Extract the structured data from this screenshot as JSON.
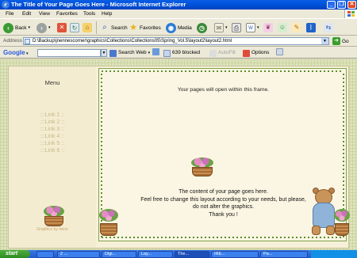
{
  "window": {
    "title": "The Title of Your Page Goes Here - Microsoft Internet Explorer",
    "minimize": "_",
    "restore": "❐",
    "close": "✕"
  },
  "menubar": {
    "items": [
      "File",
      "Edit",
      "View",
      "Favorites",
      "Tools",
      "Help"
    ]
  },
  "toolbar": {
    "back_label": "Back",
    "search_label": "Search",
    "favorites_label": "Favorites",
    "media_label": "Media"
  },
  "address": {
    "label": "Address",
    "url": "D:\\Backup\\jnennescorner\\graphics\\Collections\\Collections05\\Spring_Vol.5\\layout2\\layout2.html",
    "go_label": "Go"
  },
  "googlebar": {
    "logo": "Google",
    "search_web_label": "Search Web",
    "blocked_label": "639 blocked",
    "autofill_label": "AutoFill",
    "options_label": "Options"
  },
  "page": {
    "menu_title": "Menu",
    "links": [
      ":::Link 1 ::",
      ":::Link 2 ::",
      ":::Link 3 ::",
      ":::Link 4 ::",
      ":::Link 5 ::",
      ":::Link 6 ::"
    ],
    "credit": "Graphics by Irene",
    "frame_message": "Your pages will open within this frame.",
    "content_lines": [
      "The content of your page goes here.",
      "Feel free to change this layout according to your needs, but please,",
      "do not alter the graphics.",
      "Thank you !"
    ]
  },
  "taskbar": {
    "start_label": "start",
    "tasks": [
      "2 ...",
      "Digi...",
      "Lay...",
      "The...",
      "IRE...",
      "Pa..."
    ]
  },
  "colors": {
    "titlebar": "#0054e3",
    "page_border": "#dde3ba",
    "panel_bg": "#f7f0d8",
    "vine": "#5e8e2e",
    "link": "#c3b98a"
  }
}
